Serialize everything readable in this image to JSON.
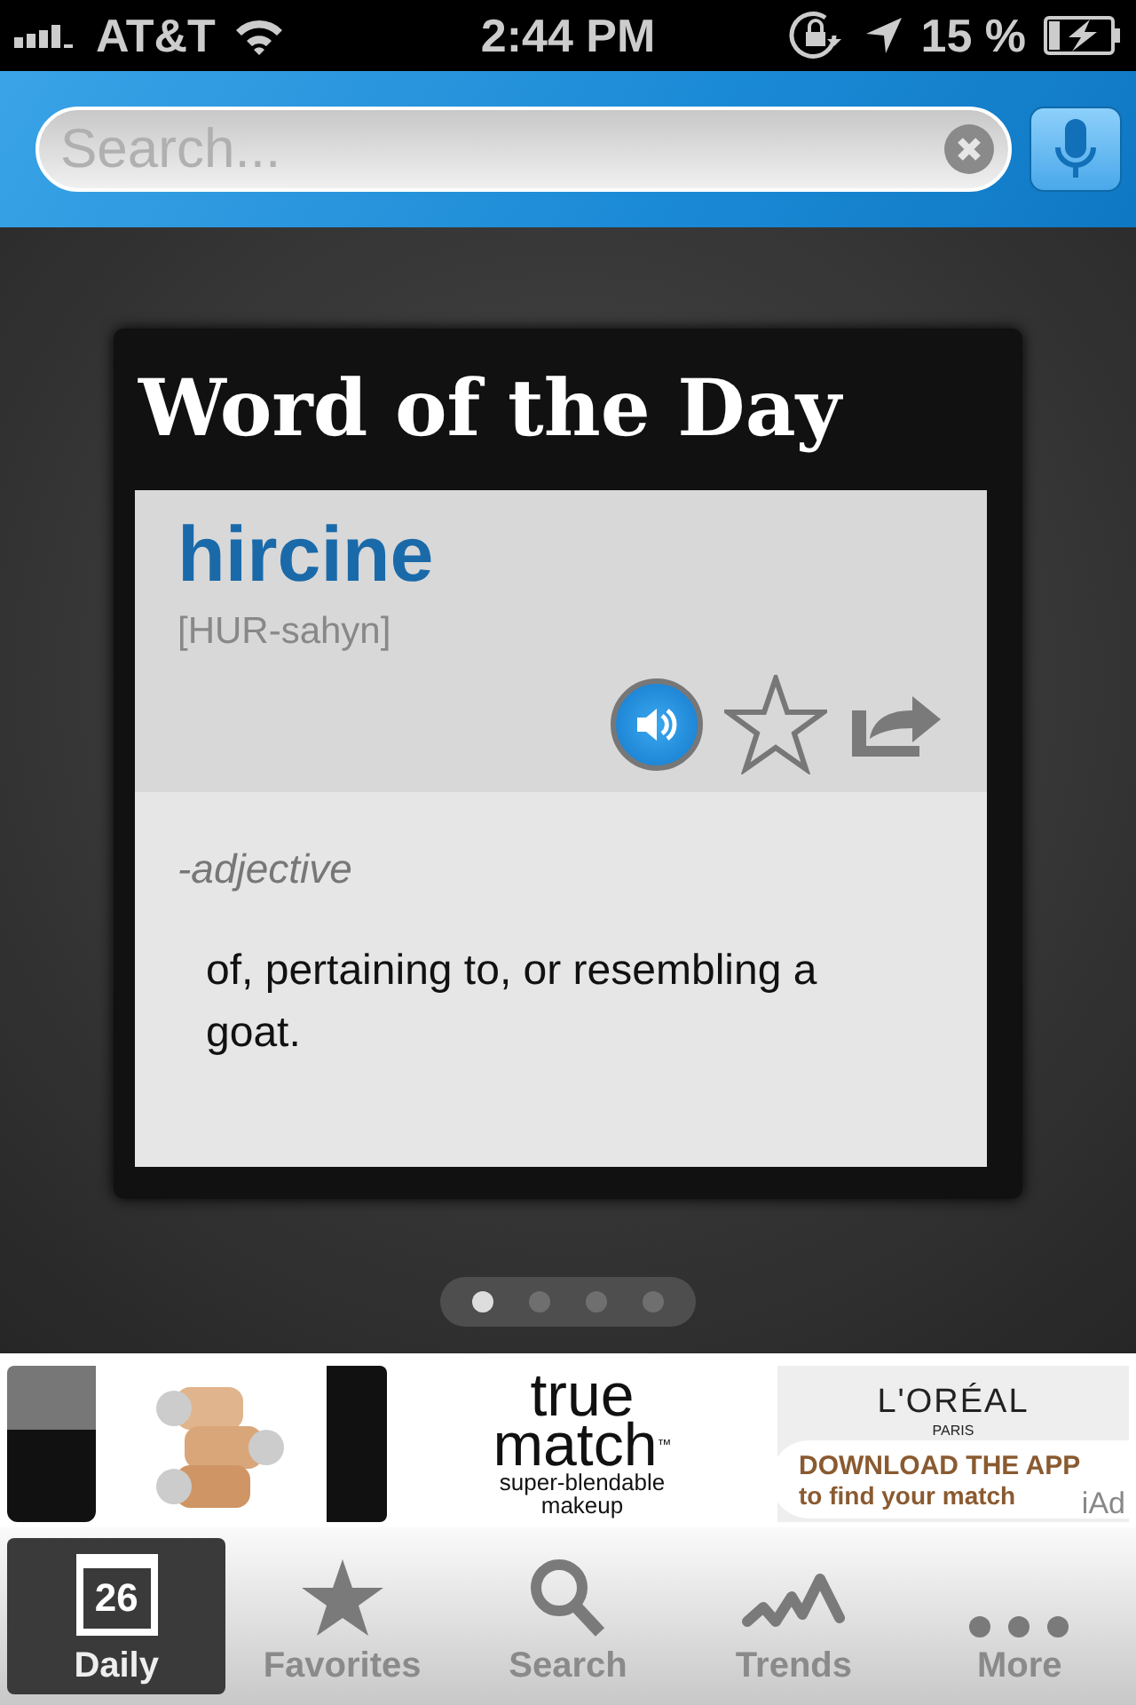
{
  "status_bar": {
    "carrier": "AT&T",
    "time": "2:44 PM",
    "battery": "15 %"
  },
  "search": {
    "placeholder": "Search..."
  },
  "card": {
    "title": "Word of the Day",
    "word": "hircine",
    "pronunciation": "[HUR-sahyn]",
    "favorite": false,
    "part_of_speech": "-adjective",
    "definition": "of, pertaining to, or resembling a goat."
  },
  "pages": [
    {
      "selected": true
    },
    {
      "selected": false
    },
    {
      "selected": false
    },
    {
      "selected": false
    }
  ],
  "ad": {
    "headline_1": "true",
    "headline_2": "match",
    "trademark": "™",
    "tagline_1": "super-blendable",
    "tagline_2": "makeup",
    "brand": "L'ORÉAL",
    "brand_sub": "PARIS",
    "cta_1": "DOWNLOAD THE APP",
    "cta_2": "to find your match",
    "network": "iAd"
  },
  "tabs": [
    {
      "label": "Daily",
      "kind": "calendar",
      "badge": "26",
      "selected": true
    },
    {
      "label": "Favorites",
      "kind": "star",
      "selected": false
    },
    {
      "label": "Search",
      "kind": "search",
      "selected": false
    },
    {
      "label": "Trends",
      "kind": "trends",
      "selected": false
    },
    {
      "label": "More",
      "kind": "more",
      "selected": false
    }
  ]
}
